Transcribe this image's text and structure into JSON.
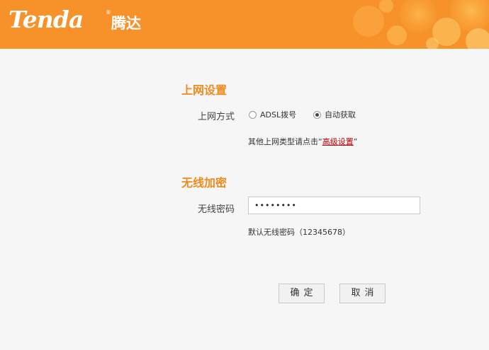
{
  "header": {
    "logo_text": "Tenda",
    "logo_reg": "®",
    "logo_cn": "腾达",
    "brand_color": "#f7922a"
  },
  "internet": {
    "title": "上网设置",
    "mode_label": "上网方式",
    "options": [
      {
        "label": "ADSL拨号",
        "checked": false
      },
      {
        "label": "自动获取",
        "checked": true
      }
    ],
    "hint_prefix": "其他上网类型请点击“",
    "hint_link": "高级设置",
    "hint_suffix": "”"
  },
  "wireless": {
    "title": "无线加密",
    "password_label": "无线密码",
    "password_value": "12345678",
    "default_hint": "默认无线密码（12345678）"
  },
  "buttons": {
    "ok": "确定",
    "cancel": "取消"
  },
  "colors": {
    "accent": "#ef8a1d",
    "link": "#c00000"
  }
}
